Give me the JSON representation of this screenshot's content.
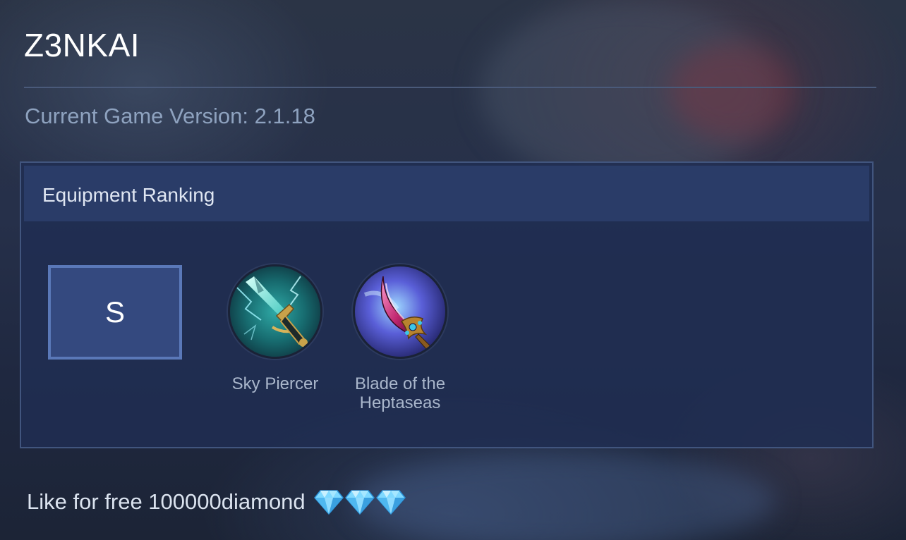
{
  "header": {
    "title": "Z3NKAI",
    "version_text": "Current Game Version: 2.1.18"
  },
  "panel": {
    "title": "Equipment Ranking",
    "tiers": [
      {
        "tier": "S",
        "items": [
          {
            "name": "Sky Piercer",
            "icon": "sky-piercer-icon"
          },
          {
            "name": "Blade of the\nHeptaseas",
            "icon": "blade-of-the-heptaseas-icon"
          }
        ]
      }
    ]
  },
  "footer": {
    "text": "Like for free 100000diamond",
    "gem_icon": "diamond-icon",
    "gem_count": 3
  },
  "colors": {
    "title": "#ffffff",
    "version": "#8ea2bf",
    "panel_bg": "#202e52",
    "tier_box": "#34497f",
    "tier_border": "#5a78b8"
  }
}
